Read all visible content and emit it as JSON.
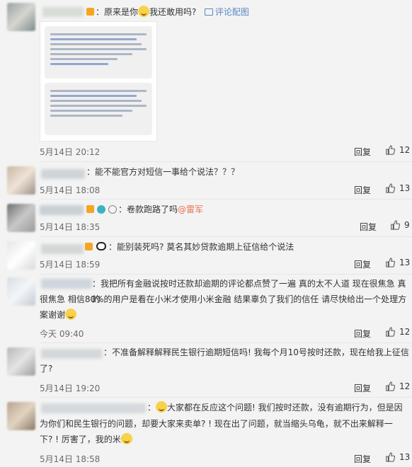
{
  "actions": {
    "reply_label": "回复"
  },
  "comments": [
    {
      "text_prefix": "原来是你",
      "text_suffix": "我还敢用吗?",
      "image_link": "评论配图",
      "time": "5月14日 20:12",
      "likes": "12"
    },
    {
      "text": "能不能官方对短信一事给个说法？？？",
      "time": "5月14日 18:08",
      "likes": "13"
    },
    {
      "text": "卷款跑路了吗",
      "mention": "@雷军",
      "time": "5月14日 18:35",
      "likes": "9"
    },
    {
      "text": "能别装死吗? 莫名其妙贷款逾期上征信给个说法",
      "time": "5月14日 18:59",
      "likes": "13"
    },
    {
      "line1": "我把所有金融说按时还款却逾期的评论都点赞了一遍 真的太不人道 现在很焦急 真的",
      "line2": "很焦急 相信80%的用户是看在小米才使用小米金融 结果辜负了我们的信任 请尽快给出一个处理方",
      "line3": "案谢谢",
      "time": "今天 09:40",
      "likes": "12"
    },
    {
      "line1": "不准备解释解释民生银行逾期短信吗! 我每个月10号按时还款，现在给我上征信",
      "line2": "了?",
      "time": "5月14日 19:20",
      "likes": "12"
    },
    {
      "line1": "大家都在反应这个问题! 我们按时还款，没有逾期行为，但是因",
      "line2": "为你们和民生银行的问题，却要大家来卖单? ! 现在出了问题，就当缩头乌龟，就不出来解释一",
      "line3": "下? ! 厉害了，我的米",
      "time": "5月14日 18:58",
      "likes": "13"
    }
  ]
}
